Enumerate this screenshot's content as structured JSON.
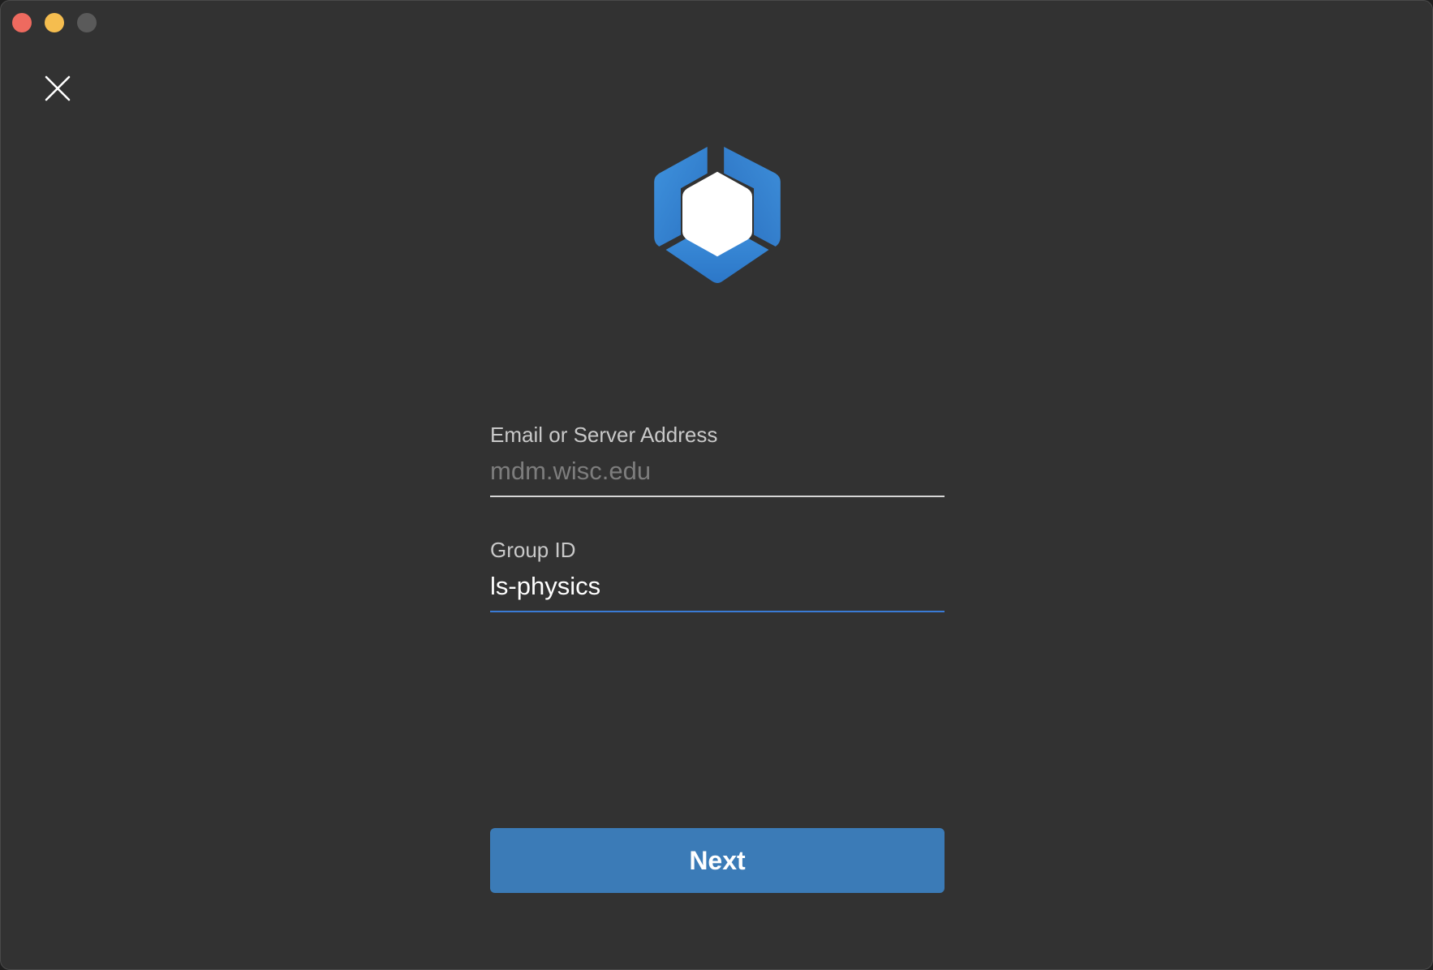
{
  "window": {
    "colors": {
      "close": "#ee6a5f",
      "minimize": "#f5bd4f",
      "zoom": "#5a5a5a",
      "accent": "#3a7bd5",
      "button": "#3b7bb7"
    }
  },
  "dialog": {
    "close_icon": "close-x-icon",
    "logo_icon": "hexagon-logo-icon"
  },
  "form": {
    "email": {
      "label": "Email or Server Address",
      "value": "",
      "placeholder": "mdm.wisc.edu"
    },
    "group": {
      "label": "Group ID",
      "value": "ls-physics",
      "placeholder": ""
    },
    "next_label": "Next"
  }
}
